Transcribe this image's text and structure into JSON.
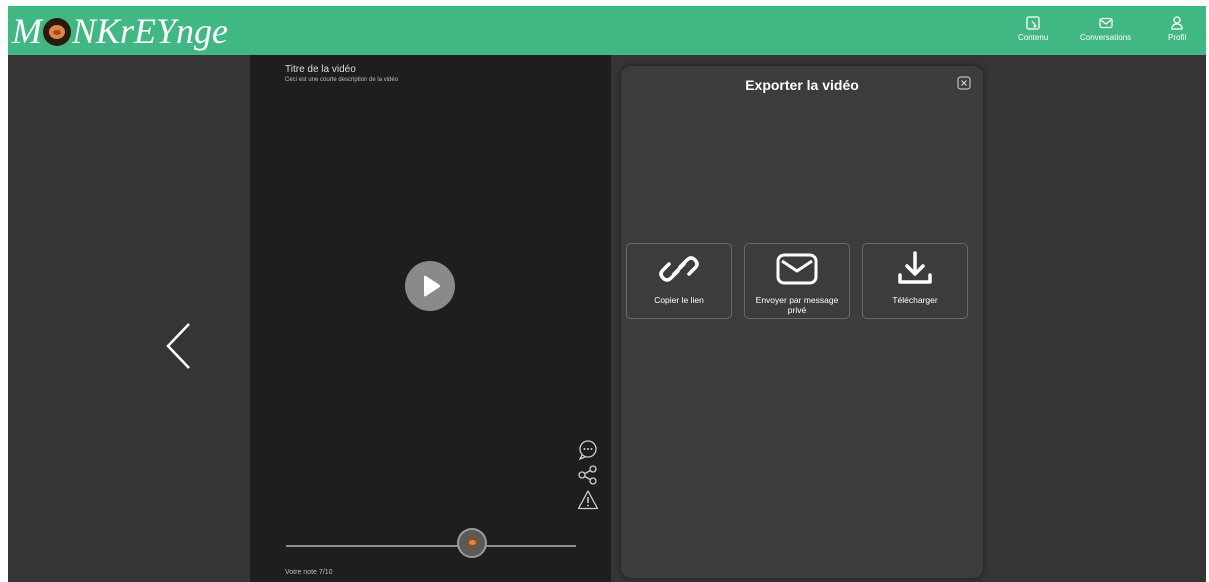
{
  "header": {
    "logo_text_start": "M",
    "logo_text_end": "NKrEYnge",
    "nav": [
      {
        "label": "Contenu",
        "icon": "content-icon"
      },
      {
        "label": "Conversations",
        "icon": "envelope-icon"
      },
      {
        "label": "Profil",
        "icon": "user-icon"
      }
    ]
  },
  "video": {
    "title": "Titre de la vidéo",
    "description": "Ceci est une courte description de la vidéo",
    "rating_label": "Votre note 7/10",
    "rating_value": 7,
    "rating_max": 10
  },
  "modal": {
    "title": "Exporter la vidéo",
    "options": [
      {
        "label": "Copier le lien",
        "icon": "link-icon"
      },
      {
        "label": "Envoyer par message privé",
        "icon": "envelope-icon"
      },
      {
        "label": "Télécharger",
        "icon": "download-icon"
      }
    ]
  },
  "colors": {
    "header_bg": "#41b883",
    "page_bg": "#353535",
    "video_bg": "#1e1e1e",
    "modal_bg": "#3c3c3c"
  }
}
